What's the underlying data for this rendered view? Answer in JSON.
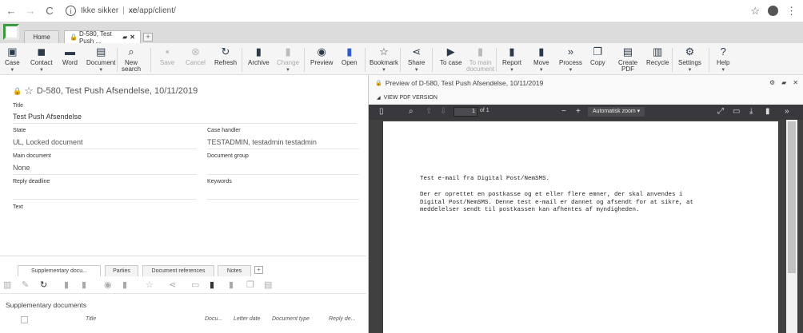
{
  "browser": {
    "back": "←",
    "forward": "→",
    "reload": "C",
    "security_text": "Ikke sikker",
    "url_host": "xe",
    "url_path": "/app/client/"
  },
  "tabs": {
    "home": "Home",
    "doc": "D-580, Test Push ...",
    "add": "+"
  },
  "toolbar": {
    "case": "Case",
    "contact": "Contact",
    "word": "Word",
    "document": "Document",
    "new_search_1": "New",
    "new_search_2": "search",
    "save": "Save",
    "cancel": "Cancel",
    "refresh": "Refresh",
    "archive": "Archive",
    "change": "Change",
    "preview": "Preview",
    "open": "Open",
    "bookmark": "Bookmark",
    "share": "Share",
    "to_case": "To case",
    "to_main_1": "To main",
    "to_main_2": "document",
    "report": "Report",
    "move": "Move",
    "process": "Process",
    "copy": "Copy",
    "create_pdf_1": "Create",
    "create_pdf_2": "PDF",
    "recycle": "Recycle",
    "settings": "Settings",
    "help": "Help"
  },
  "record": {
    "header": "D-580, Test Push Afsendelse, 10/11/2019",
    "title_label": "Title",
    "title_value": "Test Push Afsendelse",
    "state_label": "State",
    "state_value": "UL, Locked document",
    "case_handler_label": "Case handler",
    "case_handler_value": "TESTADMIN, testadmin testadmin",
    "main_doc_label": "Main document",
    "main_doc_value": "None",
    "doc_group_label": "Document group",
    "reply_deadline_label": "Reply deadline",
    "keywords_label": "Keywords",
    "text_label": "Text"
  },
  "bottom_tabs": {
    "supplementary": "Supplementary docu...",
    "parties": "Parties",
    "doc_refs": "Document references",
    "notes": "Notes",
    "add": "+"
  },
  "supp_table": {
    "heading": "Supplementary documents",
    "columns": [
      "Title",
      "Docu...",
      "Letter date",
      "Document type",
      "Reply de..."
    ]
  },
  "preview": {
    "title": "Preview of D-580, Test Push Afsendelse, 10/11/2019",
    "pdf_toggle": "VIEW PDF VERSION",
    "page_num": "1",
    "page_of": "of 1",
    "zoom": "Automatisk zoom",
    "line1": "Test e-mail fra Digital Post/NemSMS.",
    "para": "Der er oprettet en postkasse og et eller flere emner, der skal anvendes i\nDigital Post/NemSMS. Denne test e-mail er dannet og afsendt for at sikre, at\nmeddelelser sendt til postkassen kan afhentes af myndigheden."
  },
  "colors": {
    "logo_green": "#3c9b3c",
    "pdf_toolbar": "#38383d"
  }
}
